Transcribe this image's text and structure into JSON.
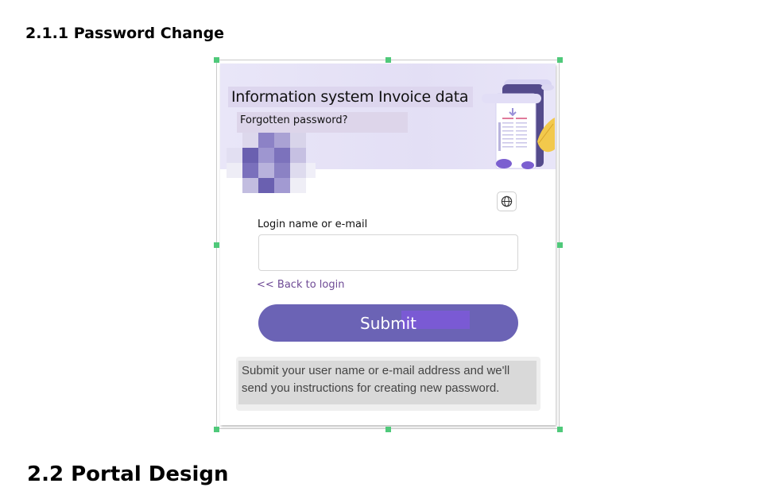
{
  "document": {
    "section_heading": "2.1.1 Password Change",
    "next_section_heading": "2.2 Portal Design"
  },
  "screenshot": {
    "banner": {
      "title": "Information system Invoice data",
      "subtitle": "Forgotten password?"
    },
    "language_icon": "globe-icon",
    "form": {
      "login_label": "Login name or e-mail",
      "login_value": "",
      "login_placeholder": "",
      "back_link": "<< Back to login",
      "submit_label": "Submit"
    },
    "info_message": "Submit your user name or e-mail address and we'll send you instructions for creating new password."
  },
  "colors": {
    "accent": "#6b63b5",
    "link": "#6e4a95",
    "banner_bg": "#e7e4f7",
    "selection_handle": "#4fc97a"
  }
}
